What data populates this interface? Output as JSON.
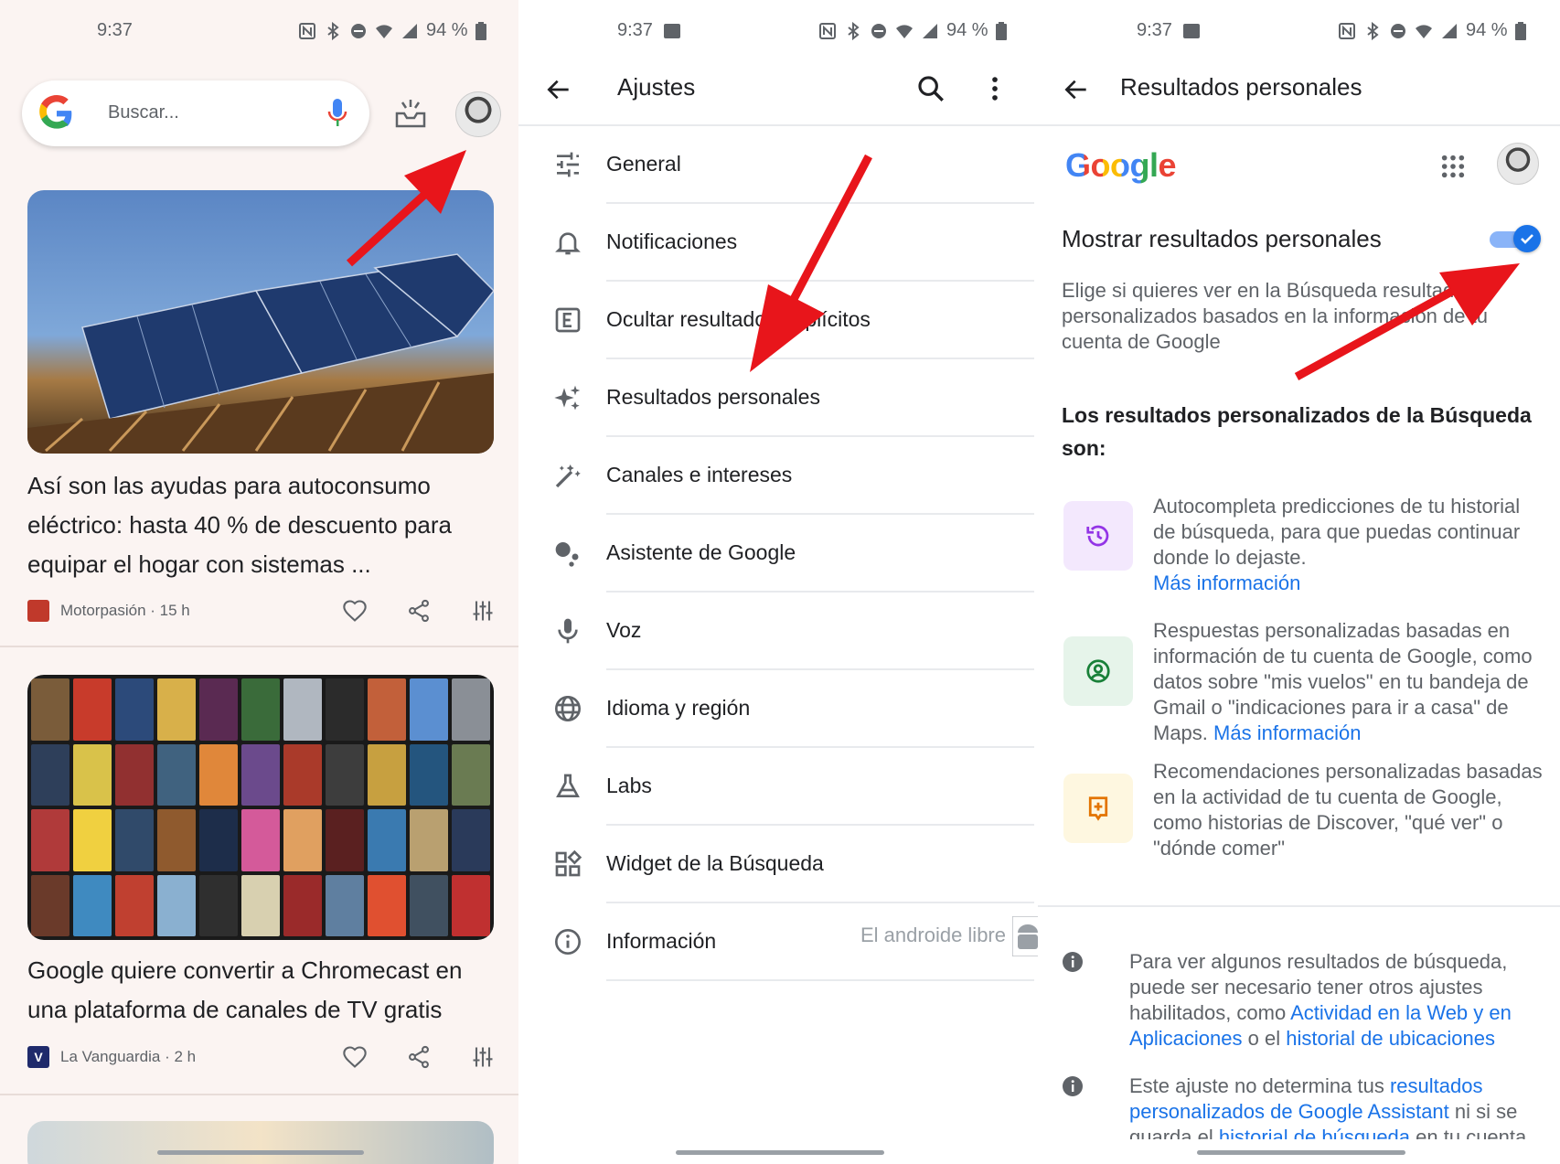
{
  "status": {
    "time": "9:37",
    "battery": "94 %"
  },
  "feed": {
    "search_placeholder": "Buscar...",
    "cards": [
      {
        "headline": "Así son las ayudas para autoconsumo eléctrico: hasta 40 % de descuento para equipar el hogar con sistemas ...",
        "source": "Motorpasión",
        "age": "15 h"
      },
      {
        "headline": "Google quiere convertir a Chromecast en una plataforma de canales de TV gratis",
        "source": "La Vanguardia",
        "age": "2 h",
        "source_logo_letter": "V"
      }
    ]
  },
  "settings": {
    "title": "Ajustes",
    "items": [
      {
        "label": "General",
        "icon": "sliders-icon"
      },
      {
        "label": "Notificaciones",
        "icon": "bell-icon"
      },
      {
        "label": "Ocultar resultados explícitos",
        "icon": "explicit-icon"
      },
      {
        "label": "Resultados personales",
        "icon": "sparkle-icon"
      },
      {
        "label": "Canales e intereses",
        "icon": "magic-wand-icon"
      },
      {
        "label": "Asistente de Google",
        "icon": "assistant-icon"
      },
      {
        "label": "Voz",
        "icon": "mic-icon"
      },
      {
        "label": "Idioma y región",
        "icon": "globe-icon"
      },
      {
        "label": "Labs",
        "icon": "flask-icon"
      },
      {
        "label": "Widget de la Búsqueda",
        "icon": "widget-icon"
      },
      {
        "label": "Información",
        "icon": "info-icon"
      }
    ],
    "watermark": "El androide libre"
  },
  "personal": {
    "title": "Resultados personales",
    "brand": "Google",
    "setting_title": "Mostrar resultados personales",
    "toggle_on": true,
    "description": "Elige si quieres ver en la Búsqueda resultados personalizados basados en la información de tu cuenta de Google",
    "subheading": "Los resultados personalizados de la Búsqueda son:",
    "features": [
      {
        "text": "Autocompleta predicciones de tu historial de búsqueda, para que puedas continuar donde lo dejaste.",
        "link": "Más información",
        "icon": "history-icon",
        "tint": "#f3e8fd",
        "color": "#9334e6"
      },
      {
        "text": "Respuestas personalizadas basadas en información de tu cuenta de Google, como datos sobre \"mis vuelos\" en tu bandeja de Gmail o \"indicaciones para ir a casa\" de Maps.",
        "link": "Más información",
        "icon": "account-circle-icon",
        "tint": "#e6f4ea",
        "color": "#188038"
      },
      {
        "text": "Recomendaciones personalizadas basadas en la actividad de tu cuenta de Google, como historias de Discover, \"qué ver\" o \"dónde comer\"",
        "icon": "recommend-icon",
        "tint": "#fef7e0",
        "color": "#e37400"
      }
    ],
    "notes": [
      {
        "pre": "Para ver algunos resultados de búsqueda, puede ser necesario tener otros ajustes habilitados, como",
        "link1": "Actividad en la Web y en Aplicaciones",
        "mid": "o el",
        "link2": "historial de ubicaciones"
      },
      {
        "pre": "Este ajuste no determina tus",
        "link1": "resultados personalizados de Google Assistant",
        "mid": "ni si se guarda el",
        "link2": "historial de búsqueda",
        "post": "en tu cuenta"
      }
    ]
  },
  "colors": {
    "accent": "#1a73e8",
    "arrow": "#e8151b"
  }
}
